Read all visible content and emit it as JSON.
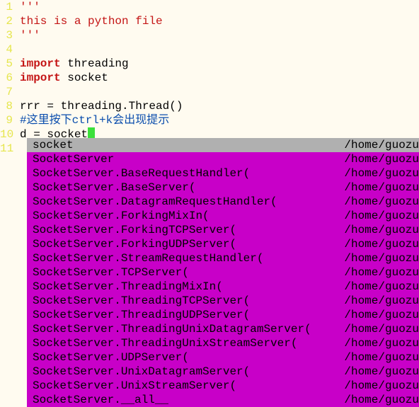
{
  "lines": [
    {
      "num": "1",
      "segments": [
        {
          "cls": "str",
          "text": "'''"
        }
      ]
    },
    {
      "num": "2",
      "segments": [
        {
          "cls": "str",
          "text": "this is a python file"
        }
      ]
    },
    {
      "num": "3",
      "segments": [
        {
          "cls": "str",
          "text": "'''"
        }
      ]
    },
    {
      "num": "4",
      "segments": []
    },
    {
      "num": "5",
      "segments": [
        {
          "cls": "kw",
          "text": "import"
        },
        {
          "cls": "",
          "text": " threading"
        }
      ]
    },
    {
      "num": "6",
      "segments": [
        {
          "cls": "kw",
          "text": "import"
        },
        {
          "cls": "",
          "text": " socket"
        }
      ]
    },
    {
      "num": "7",
      "segments": []
    },
    {
      "num": "8",
      "segments": [
        {
          "cls": "",
          "text": "rrr = threading.Thread()"
        }
      ]
    },
    {
      "num": "9",
      "segments": [
        {
          "cls": "cm",
          "text": "#这里按下ctrl+k会出现提示"
        }
      ]
    },
    {
      "num": "10",
      "segments": [
        {
          "cls": "",
          "text": "d = socket"
        }
      ],
      "cursor": true
    },
    {
      "num": "11",
      "segments": []
    }
  ],
  "completion": {
    "selected": 0,
    "items": [
      {
        "name": "socket",
        "path": "/home/guozu"
      },
      {
        "name": "SocketServer",
        "path": "/home/guozu"
      },
      {
        "name": "SocketServer.BaseRequestHandler(",
        "path": "/home/guozu"
      },
      {
        "name": "SocketServer.BaseServer(",
        "path": "/home/guozu"
      },
      {
        "name": "SocketServer.DatagramRequestHandler(",
        "path": "/home/guozu"
      },
      {
        "name": "SocketServer.ForkingMixIn(",
        "path": "/home/guozu"
      },
      {
        "name": "SocketServer.ForkingTCPServer(",
        "path": "/home/guozu"
      },
      {
        "name": "SocketServer.ForkingUDPServer(",
        "path": "/home/guozu"
      },
      {
        "name": "SocketServer.StreamRequestHandler(",
        "path": "/home/guozu"
      },
      {
        "name": "SocketServer.TCPServer(",
        "path": "/home/guozu"
      },
      {
        "name": "SocketServer.ThreadingMixIn(",
        "path": "/home/guozu"
      },
      {
        "name": "SocketServer.ThreadingTCPServer(",
        "path": "/home/guozu"
      },
      {
        "name": "SocketServer.ThreadingUDPServer(",
        "path": "/home/guozu"
      },
      {
        "name": "SocketServer.ThreadingUnixDatagramServer(",
        "path": "/home/guozu"
      },
      {
        "name": "SocketServer.ThreadingUnixStreamServer(",
        "path": "/home/guozu"
      },
      {
        "name": "SocketServer.UDPServer(",
        "path": "/home/guozu"
      },
      {
        "name": "SocketServer.UnixDatagramServer(",
        "path": "/home/guozu"
      },
      {
        "name": "SocketServer.UnixStreamServer(",
        "path": "/home/guozu"
      },
      {
        "name": "SocketServer.__all__",
        "path": "/home/guozu"
      }
    ]
  }
}
